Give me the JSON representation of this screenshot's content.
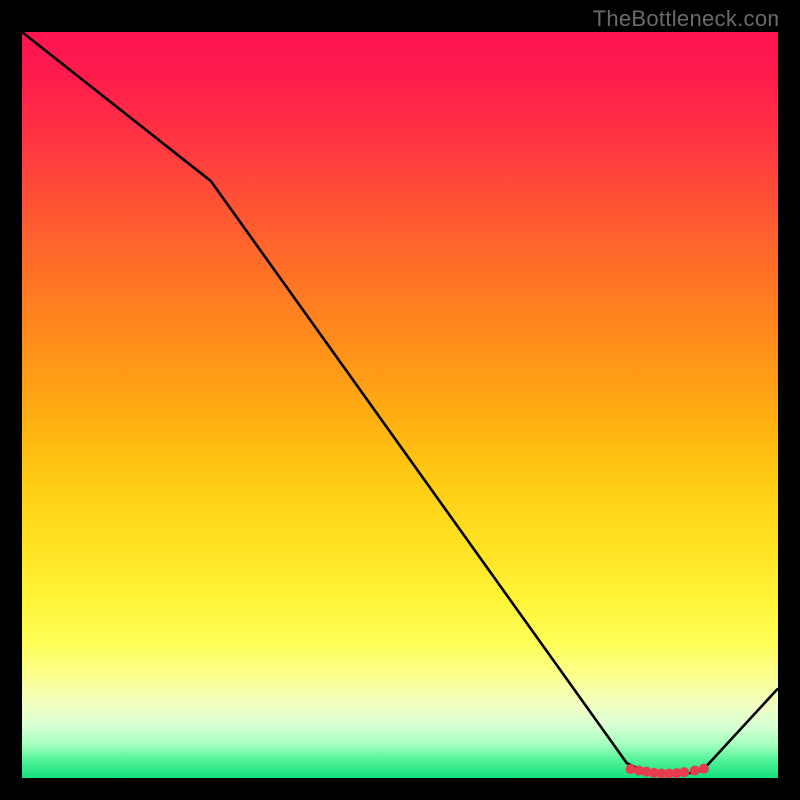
{
  "attribution": "TheBottleneck.com",
  "chart_data": {
    "type": "line",
    "title": "",
    "xlabel": "",
    "ylabel": "",
    "xlim": [
      0,
      100
    ],
    "ylim": [
      0,
      100
    ],
    "grid": false,
    "series": [
      {
        "name": "curve",
        "x": [
          0,
          25,
          80,
          82,
          84,
          86,
          88,
          90,
          100
        ],
        "y": [
          100,
          80,
          2,
          1.0,
          0.6,
          0.6,
          0.6,
          1.0,
          12
        ]
      }
    ],
    "markers": {
      "name": "bottom-cluster",
      "x": [
        80.5,
        81.6,
        82.6,
        83.6,
        84.6,
        85.6,
        86.6,
        87.6,
        89.0,
        90.2
      ],
      "y": [
        1.2,
        1.0,
        0.85,
        0.7,
        0.6,
        0.6,
        0.65,
        0.78,
        1.0,
        1.25
      ],
      "color": "#e63c4b",
      "radius_px": 5
    },
    "background_gradient": {
      "top": "#ff1452",
      "bottom": "#11e07e"
    }
  }
}
